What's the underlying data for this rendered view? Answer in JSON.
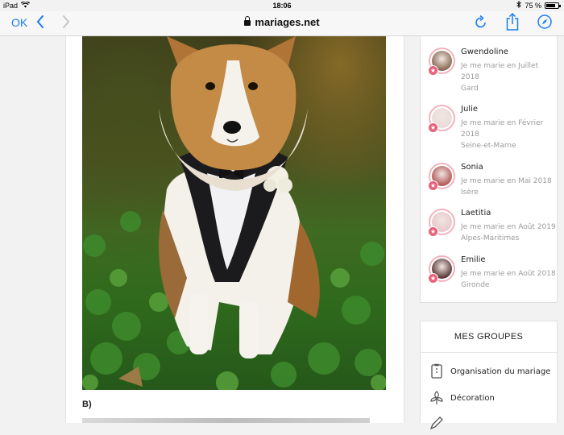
{
  "status_bar": {
    "device": "iPad",
    "time": "18:06",
    "battery": "75 %",
    "battery_level": 0.75
  },
  "toolbar": {
    "done_label": "OK",
    "url": "mariages.net"
  },
  "article": {
    "caption": "B)"
  },
  "members": [
    {
      "name": "Gwendoline",
      "line1": "Je me marie en Juillet",
      "line2": "2018",
      "line3": "Gard",
      "color": "#8a6a55"
    },
    {
      "name": "Julie",
      "line1": "Je me marie en Février",
      "line2": "2018",
      "line3": "Seine-et-Marne",
      "color": "#e9dcd8"
    },
    {
      "name": "Sonia",
      "line1": "Je me marie en Mai 2018",
      "line2": "Isère",
      "color": "#b55a5a"
    },
    {
      "name": "Laetitia",
      "line1": "Je me marie en Août 2019",
      "line2": "Alpes-Maritimes",
      "color": "#e7c9cc"
    },
    {
      "name": "Emilie",
      "line1": "Je me marie en Août 2018",
      "line2": "Gironde",
      "color": "#5a3a3a"
    }
  ],
  "groups": {
    "title": "MES GROUPES",
    "items": [
      {
        "label": "Organisation du mariage",
        "icon": "checklist-icon"
      },
      {
        "label": "Décoration",
        "icon": "flower-decoration-icon"
      },
      {
        "label": "",
        "icon": "pen-icon"
      }
    ]
  }
}
